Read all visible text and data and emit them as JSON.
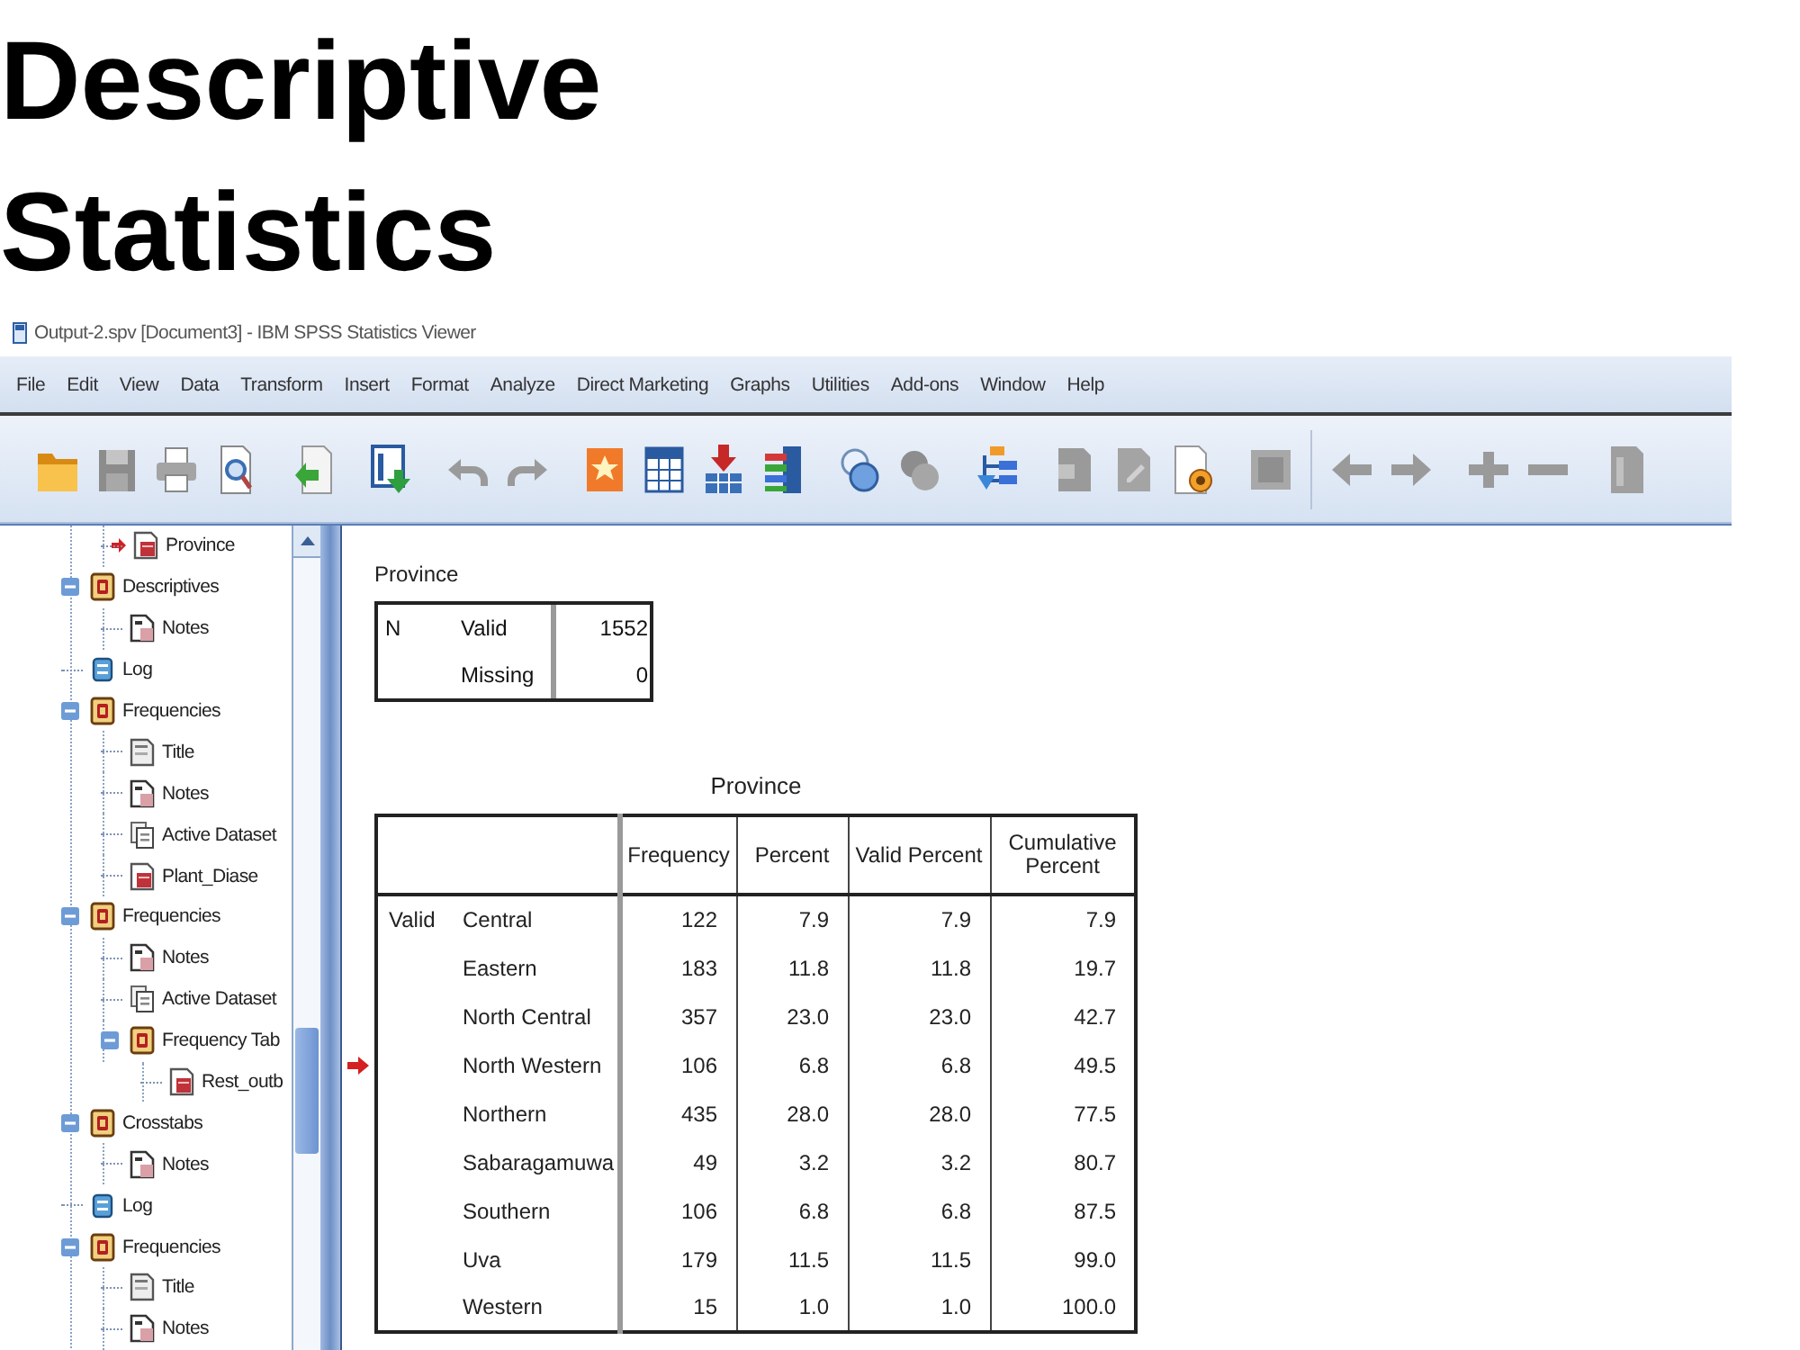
{
  "heading": "Descriptive Statistics",
  "window": {
    "title": "Output-2.spv [Document3] - IBM SPSS Statistics Viewer"
  },
  "menu": [
    "File",
    "Edit",
    "View",
    "Data",
    "Transform",
    "Insert",
    "Format",
    "Analyze",
    "Direct Marketing",
    "Graphs",
    "Utilities",
    "Add-ons",
    "Window",
    "Help"
  ],
  "outline": {
    "items": [
      {
        "children": [
          {
            "label": "Province",
            "kind": "table",
            "current": true
          }
        ]
      },
      {
        "label": "Descriptives",
        "kind": "procedure",
        "current": false,
        "expanded": true,
        "children": [
          {
            "label": "Notes",
            "kind": "notes",
            "current": false
          }
        ]
      },
      {
        "label": "Log",
        "kind": "log",
        "current": false
      },
      {
        "label": "Frequencies",
        "kind": "procedure",
        "current": false,
        "expanded": true,
        "children": [
          {
            "label": "Title",
            "kind": "title",
            "current": false
          },
          {
            "label": "Notes",
            "kind": "notes",
            "current": false
          },
          {
            "label": "Active Dataset",
            "kind": "dataset",
            "current": false
          },
          {
            "label": "Plant_Diase",
            "kind": "table",
            "current": false
          }
        ]
      },
      {
        "label": "Frequencies",
        "kind": "procedure",
        "current": false,
        "expanded": true,
        "children": [
          {
            "label": "Notes",
            "kind": "notes",
            "current": false
          },
          {
            "label": "Active Dataset",
            "kind": "dataset",
            "current": false
          },
          {
            "label": "Frequency Tab",
            "kind": "procedure",
            "current": false,
            "expanded": true,
            "children": [
              {
                "label": "Rest_outb",
                "kind": "table",
                "current": false
              }
            ]
          }
        ]
      },
      {
        "label": "Crosstabs",
        "kind": "procedure",
        "current": false,
        "expanded": true,
        "children": [
          {
            "label": "Notes",
            "kind": "notes",
            "current": false
          }
        ]
      },
      {
        "label": "Log",
        "kind": "log",
        "current": false
      },
      {
        "label": "Frequencies",
        "kind": "procedure",
        "current": false,
        "expanded": true,
        "children": [
          {
            "label": "Title",
            "kind": "title",
            "current": false
          },
          {
            "label": "Notes",
            "kind": "notes",
            "current": false
          }
        ]
      }
    ]
  },
  "statistics": {
    "title": "Province",
    "group": "N",
    "rows": [
      {
        "label": "Valid",
        "value": "1552"
      },
      {
        "label": "Missing",
        "value": "0"
      }
    ]
  },
  "frequencies": {
    "title": "Province",
    "columns": [
      "Frequency",
      "Percent",
      "Valid Percent",
      "Cumulative Percent"
    ],
    "group": "Valid",
    "rows": [
      {
        "label": "Central",
        "values": [
          "122",
          "7.9",
          "7.9",
          "7.9"
        ]
      },
      {
        "label": "Eastern",
        "values": [
          "183",
          "11.8",
          "11.8",
          "19.7"
        ]
      },
      {
        "label": "North Central",
        "values": [
          "357",
          "23.0",
          "23.0",
          "42.7"
        ]
      },
      {
        "label": "North Western",
        "values": [
          "106",
          "6.8",
          "6.8",
          "49.5"
        ]
      },
      {
        "label": "Northern",
        "values": [
          "435",
          "28.0",
          "28.0",
          "77.5"
        ]
      },
      {
        "label": "Sabaragamuwa",
        "values": [
          "49",
          "3.2",
          "3.2",
          "80.7"
        ]
      },
      {
        "label": "Southern",
        "values": [
          "106",
          "6.8",
          "6.8",
          "87.5"
        ]
      },
      {
        "label": "Uva",
        "values": [
          "179",
          "11.5",
          "11.5",
          "99.0"
        ]
      },
      {
        "label": "Western",
        "values": [
          "15",
          "1.0",
          "1.0",
          "100.0"
        ]
      }
    ]
  }
}
